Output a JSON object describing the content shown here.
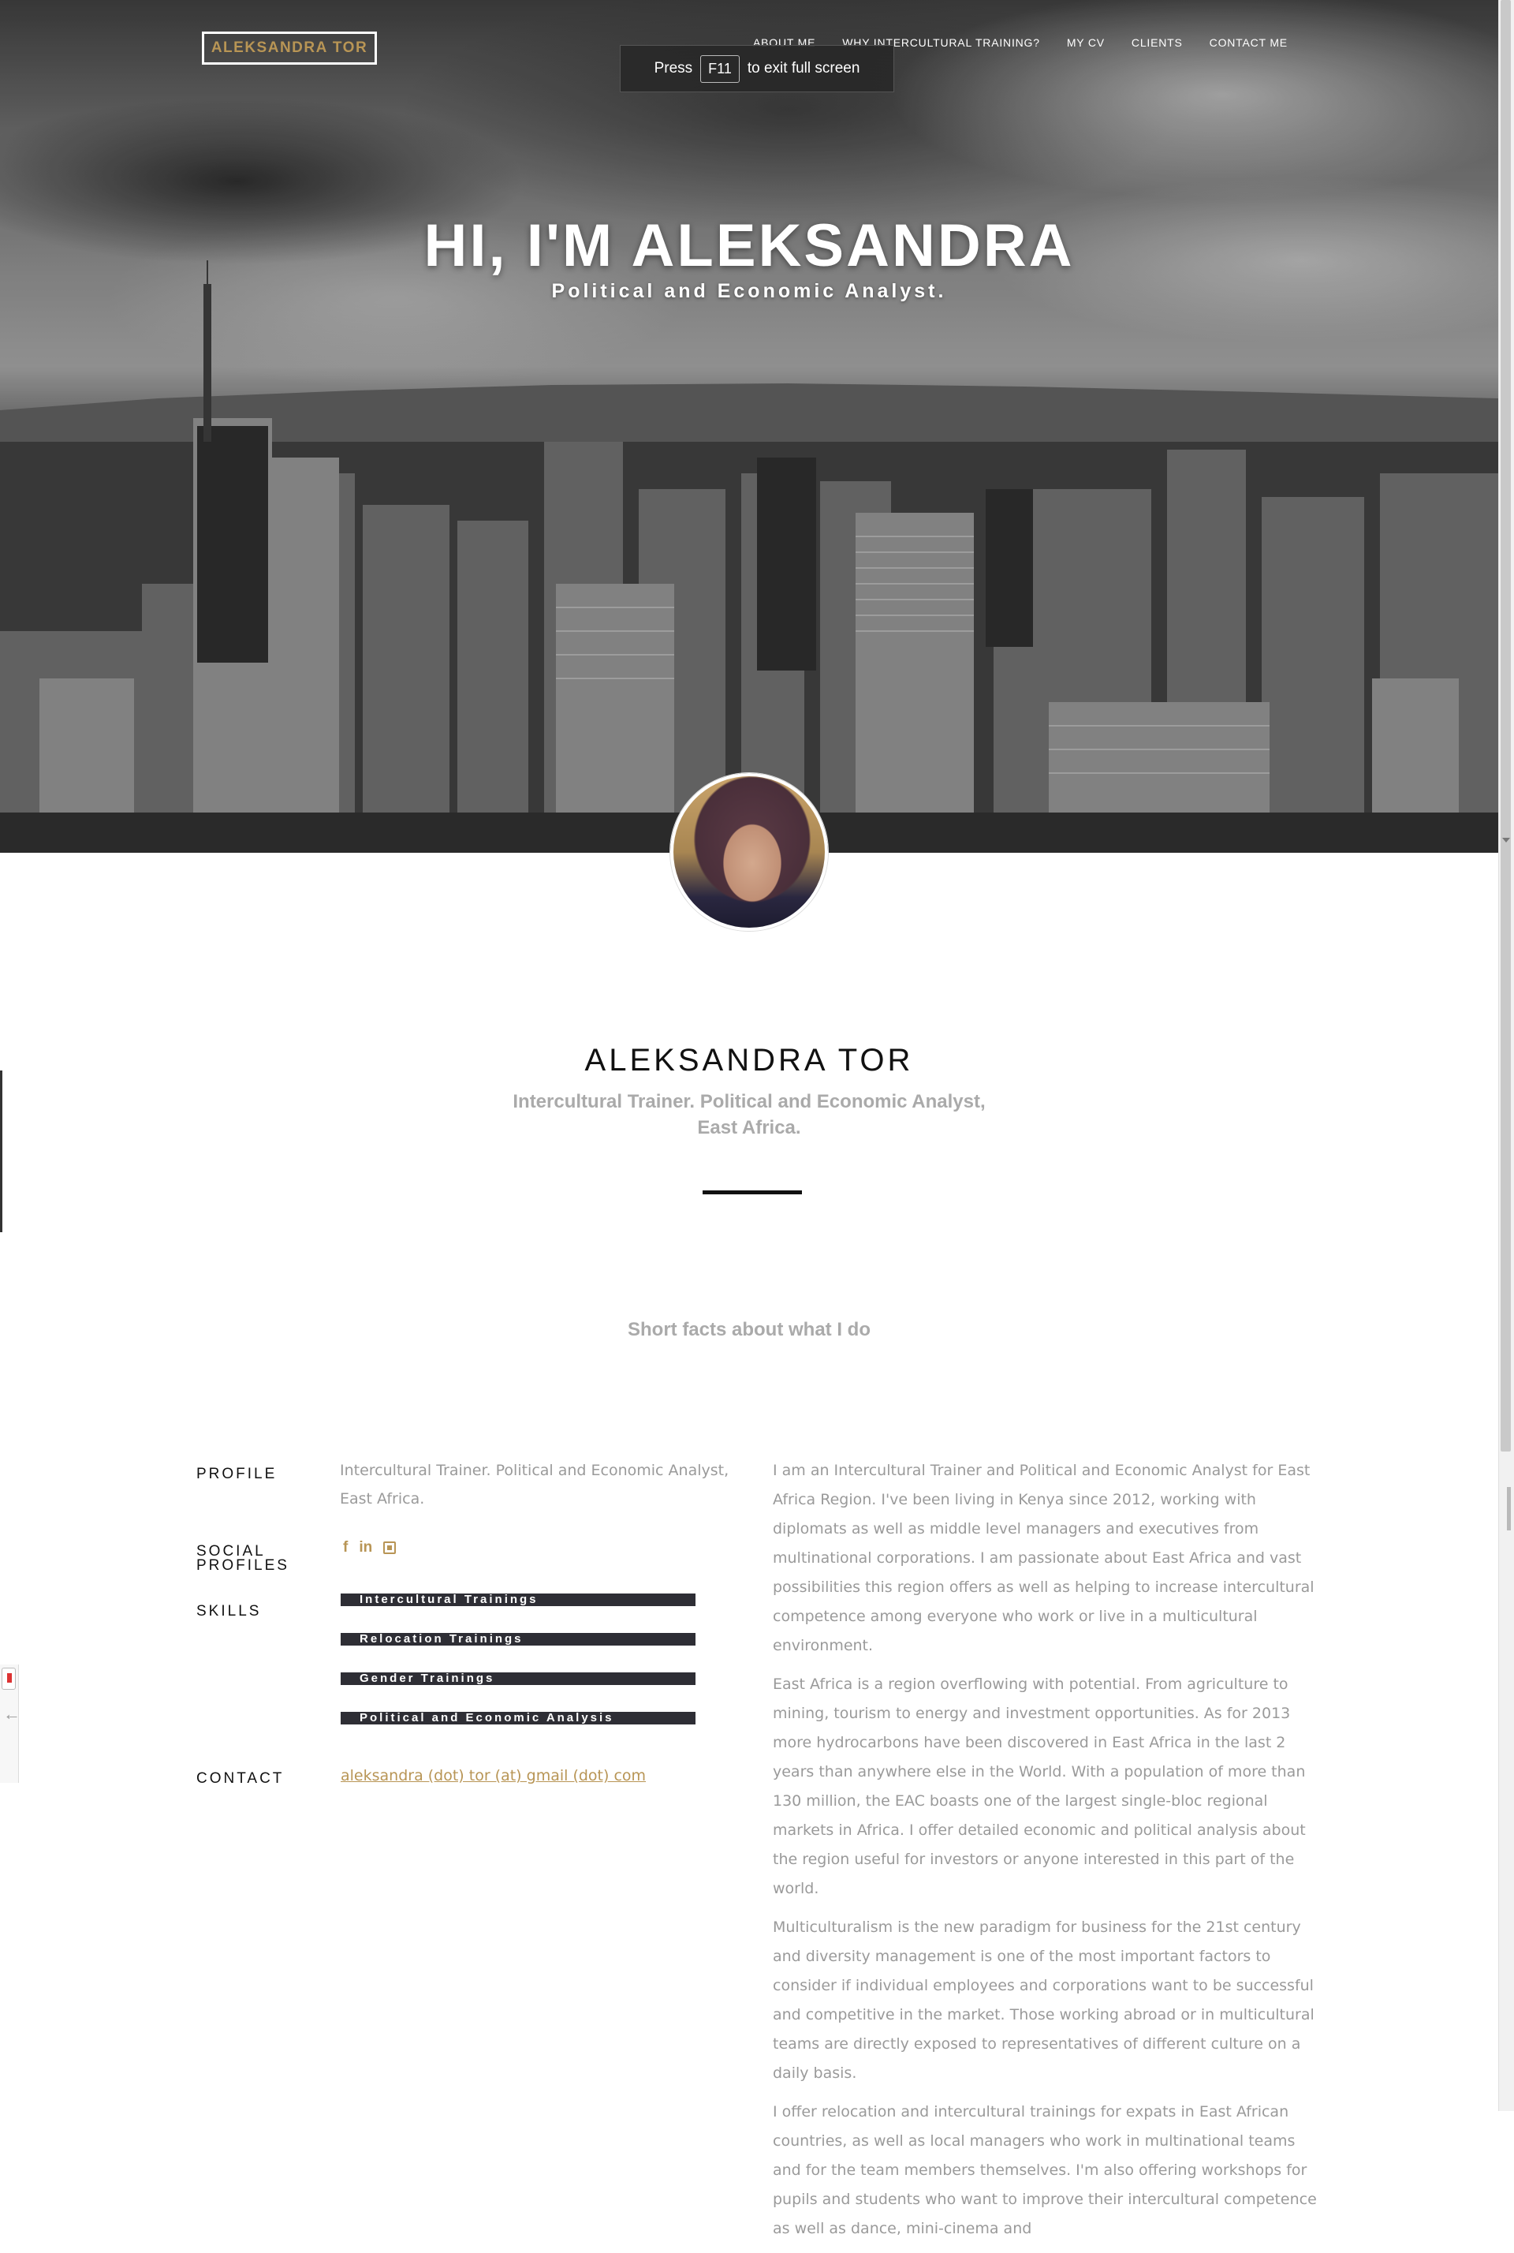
{
  "header": {
    "logo": "ALEKSANDRA TOR",
    "nav": [
      "ABOUT ME",
      "WHY INTERCULTURAL TRAINING?",
      "MY CV",
      "CLIENTS",
      "CONTACT ME"
    ]
  },
  "fullscreen_notice": {
    "before": "Press",
    "key": "F11",
    "after": "to exit full screen"
  },
  "hero": {
    "title": "HI, I'M ALEKSANDRA",
    "subtitle": "Political and Economic Analyst."
  },
  "intro": {
    "name": "ALEKSANDRA TOR",
    "tagline_line1": "Intercultural Trainer. Political and Economic Analyst,",
    "tagline_line2": "East Africa.",
    "facts_heading": "Short facts about what I do"
  },
  "profile": {
    "profile_label": "PROFILE",
    "profile_text": "Intercultural Trainer. Political and Economic Analyst, East Africa.",
    "social_label_line1": "SOCIAL",
    "social_label_line2": "PROFILES",
    "social_icons": [
      "facebook-icon",
      "linkedin-icon",
      "youtube-icon"
    ],
    "social_glyphs": {
      "facebook": "f",
      "linkedin": "in"
    },
    "skills_label": "SKILLS",
    "skills": [
      "Intercultural Trainings",
      "Relocation Trainings",
      "Gender Trainings",
      "Political and Economic Analysis"
    ],
    "contact_label": "CONTACT",
    "contact_email": "aleksandra (dot) tor (at) gmail (dot) com"
  },
  "bio": {
    "p1": "I am an Intercultural Trainer and Political and Economic Analyst for East Africa Region. I've been living in Kenya since 2012, working with diplomats as well as middle level managers and executives from multinational corporations. I am passionate about East Africa and vast possibilities this region offers as well as helping to increase intercultural competence among everyone who work or live in a multicultural environment.",
    "p2": "East Africa is a region overflowing with potential. From agriculture to mining, tourism to energy and investment opportunities. As for 2013 more hydrocarbons have been discovered in East Africa in the last 2 years than anywhere else in the World. With a population of more than 130 million, the EAC boasts one of the largest single-bloc regional markets in Africa. I offer detailed economic and political analysis about the region useful for investors or anyone interested in this part of the world.",
    "p3": "Multiculturalism is the new paradigm for business for the 21st century and diversity management is one of the most important factors to consider if individual employees and corporations want to be successful and competitive in the market. Those working abroad or in multicultural teams are directly exposed to representatives of different culture on a daily basis.",
    "p4": "I offer relocation and intercultural trainings for expats in East African countries, as well as local managers who work in multinational teams and for the team members themselves. I'm also offering workshops for pupils and students who want to improve their intercultural competence as well as dance, mini-cinema and"
  },
  "colors": {
    "accent_gold": "#b89555",
    "skill_bar": "#2e2e35",
    "muted_text": "#9a9a9a"
  }
}
